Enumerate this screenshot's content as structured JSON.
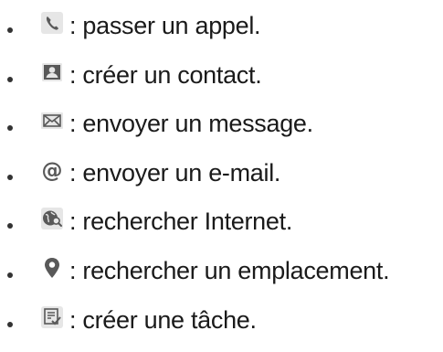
{
  "items": [
    {
      "icon": "phone-icon",
      "label": ": passer un appel."
    },
    {
      "icon": "contact-card-icon",
      "label": ": créer un contact."
    },
    {
      "icon": "envelope-icon",
      "label": ": envoyer un message."
    },
    {
      "icon": "at-sign-icon",
      "label": ": envoyer un e-mail."
    },
    {
      "icon": "web-search-icon",
      "label": ": rechercher Internet."
    },
    {
      "icon": "location-pin-icon",
      "label": ": rechercher un emplacement."
    },
    {
      "icon": "task-icon",
      "label": ": créer une tâche."
    }
  ],
  "colors": {
    "icon_gray": "#595959",
    "icon_bg": "#d9d9d9",
    "text": "#1a1a1a"
  }
}
